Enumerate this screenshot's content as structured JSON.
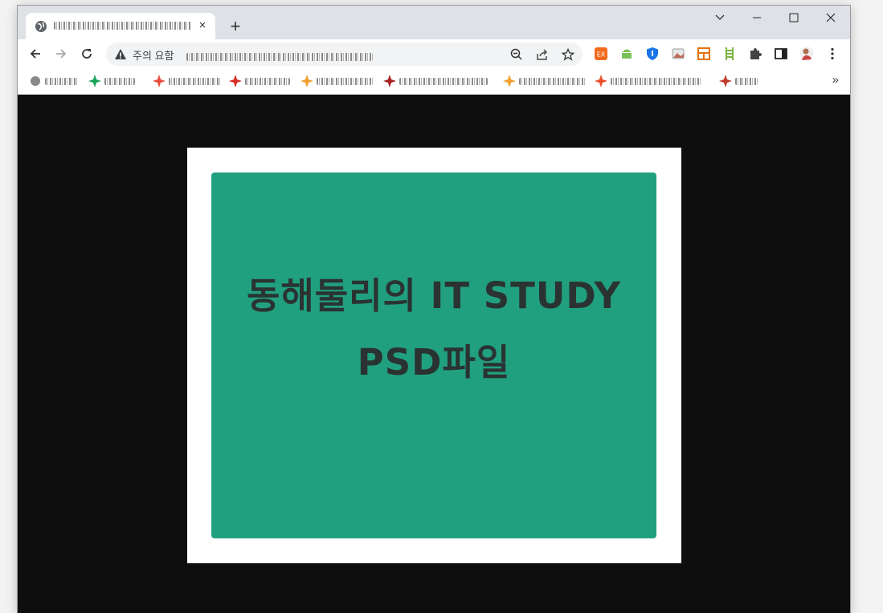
{
  "browser": {
    "tab": {
      "icon": "globe-icon",
      "close": "×"
    },
    "new_tab": "+",
    "window_controls": [
      "chevron-down-icon",
      "minimize-icon",
      "maximize-icon",
      "close-icon"
    ],
    "address_bar": {
      "security_label": "주의 요함",
      "security_icon": "warning-icon"
    },
    "address_icons": [
      "zoom-out-icon",
      "share-icon",
      "star-icon"
    ],
    "extensions": [
      {
        "name": "ex-extension-icon",
        "color": "#f26b1d"
      },
      {
        "name": "android-icon",
        "color": "#78c257"
      },
      {
        "name": "shield-extension-icon",
        "color": "#1a73e8"
      },
      {
        "name": "image-extension-icon",
        "color": "#c26a5a"
      },
      {
        "name": "layout-extension-icon",
        "color": "#e8710a"
      },
      {
        "name": "ladder-extension-icon",
        "color": "#7cb342"
      },
      {
        "name": "puzzle-icon",
        "color": "#5f6368"
      },
      {
        "name": "sidepanel-icon",
        "color": "#202124"
      },
      {
        "name": "profile-avatar",
        "color": "#b07050"
      },
      {
        "name": "kebab-menu-icon",
        "color": "#5f6368"
      }
    ],
    "bookmarks_more": "»"
  },
  "page": {
    "line1": "동해둘리의 IT STUDY",
    "line2": "PSD파일",
    "card_color": "#21a080",
    "background_color": "#0e0e0e"
  }
}
